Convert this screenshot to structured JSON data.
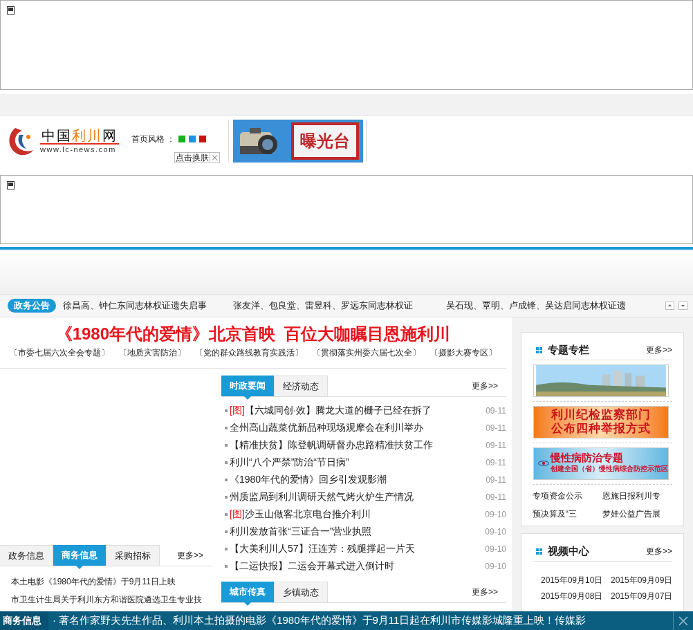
{
  "header": {
    "logo": {
      "parts": [
        {
          "text": "中国",
          "accent": false
        },
        {
          "text": "利川",
          "accent": true
        },
        {
          "text": "网",
          "accent": false
        }
      ],
      "url": "www.lc-news.com"
    },
    "skin": {
      "label": "首页风格 ：",
      "swatches": [
        {
          "color": "#17b31b",
          "selected": false
        },
        {
          "color": "#1b96dd",
          "selected": false
        },
        {
          "color": "#cc1111",
          "selected": false
        }
      ]
    },
    "tooltip": "点击换肤",
    "banner": {
      "caption": "曝光台"
    }
  },
  "notice": {
    "badge": "政务公告",
    "items": [
      "徐昌高、钟仁东同志林权证遗失启事",
      "张友洋、包良堂、雷昱科、罗远东同志林权证",
      "吴石现、覃明、卢成锋、吴达启同志林权证遗"
    ]
  },
  "headline": {
    "title": "《1980年代的爱情》北京首映  百位大咖瞩目恩施利川",
    "links": [
      "〔市委七届六次全会专题〕",
      "〔地质灾害防治〕",
      "〔党的群众路线教育实践活〕",
      "〔贯彻落实州委六届七次全〕",
      "〔摄影大赛专区〕"
    ]
  },
  "news": {
    "tabs": [
      {
        "label": "时政要闻",
        "selected": true
      },
      {
        "label": "经济动态",
        "selected": false
      }
    ],
    "more": "更多>>",
    "items": [
      {
        "tag": "[图]",
        "title": "【六城同创·效】腾龙大道的栅子已经在拆了",
        "date": "09-11"
      },
      {
        "title": "全州高山蔬菜优新品种现场观摩会在利川举办",
        "date": "09-11"
      },
      {
        "title": "【精准扶贫】陈登帆调研督办忠路精准扶贫工作",
        "date": "09-11"
      },
      {
        "title": "利川“八个严禁”防治“节日病”",
        "date": "09-11"
      },
      {
        "title": "《1980年代的爱情》回乡引发观影潮",
        "date": "09-11"
      },
      {
        "title": "州质监局到利川调研天然气烤火炉生产情况",
        "date": "09-11"
      },
      {
        "tag": "[图]",
        "title": "沙玉山做客北京电台推介利川",
        "date": "09-10"
      },
      {
        "title": "利川发放首张“三证合一”营业执照",
        "date": "09-10"
      },
      {
        "title": "【大美利川人57】汪连芳：残腿撑起一片天",
        "date": "09-10"
      },
      {
        "title": "【二运快报】二运会开幕式进入倒计时",
        "date": "09-10"
      }
    ]
  },
  "city": {
    "tabs": [
      {
        "label": "城市传真",
        "selected": true
      },
      {
        "label": "乡镇动态",
        "selected": false
      }
    ],
    "more": "更多>>"
  },
  "business": {
    "tabs": [
      {
        "label": "政务信息",
        "selected": false
      },
      {
        "label": "商务信息",
        "selected": true
      },
      {
        "label": "采购招标",
        "selected": false
      }
    ],
    "more": "更多>>",
    "items": [
      "本土电影《1980年代的爱情》于9月11日上映",
      "市卫生计生局关于利川东方和谐医院遴选卫生专业技"
    ]
  },
  "special": {
    "title": "专题专栏",
    "more": "更多>>",
    "banners": [
      {
        "kind": "picture"
      },
      {
        "kind": "orange",
        "lines": [
          "利川纪检监察部门",
          "公布四种举报方式"
        ]
      },
      {
        "kind": "blue",
        "lines": [
          "慢性病防治专题",
          "创建全国（省）慢性病综合防控示范区"
        ]
      }
    ],
    "links": [
      "专项资金公示",
      "恩施日报利川专",
      "预决算及“三",
      "梦娃公益广告展"
    ]
  },
  "video": {
    "title": "视频中心",
    "more": "更多>>",
    "items": [
      "2015年09月10日",
      "2015年09月09日",
      "2015年09月08日",
      "2015年09月07日"
    ]
  },
  "bottom_bar": {
    "label": "商务信息",
    "text": "· 著名作家野夫先生作品、利川本土拍摄的电影《1980年代的爱情》于9月11日起在利川市传媒影城隆重上映！传媒影"
  }
}
